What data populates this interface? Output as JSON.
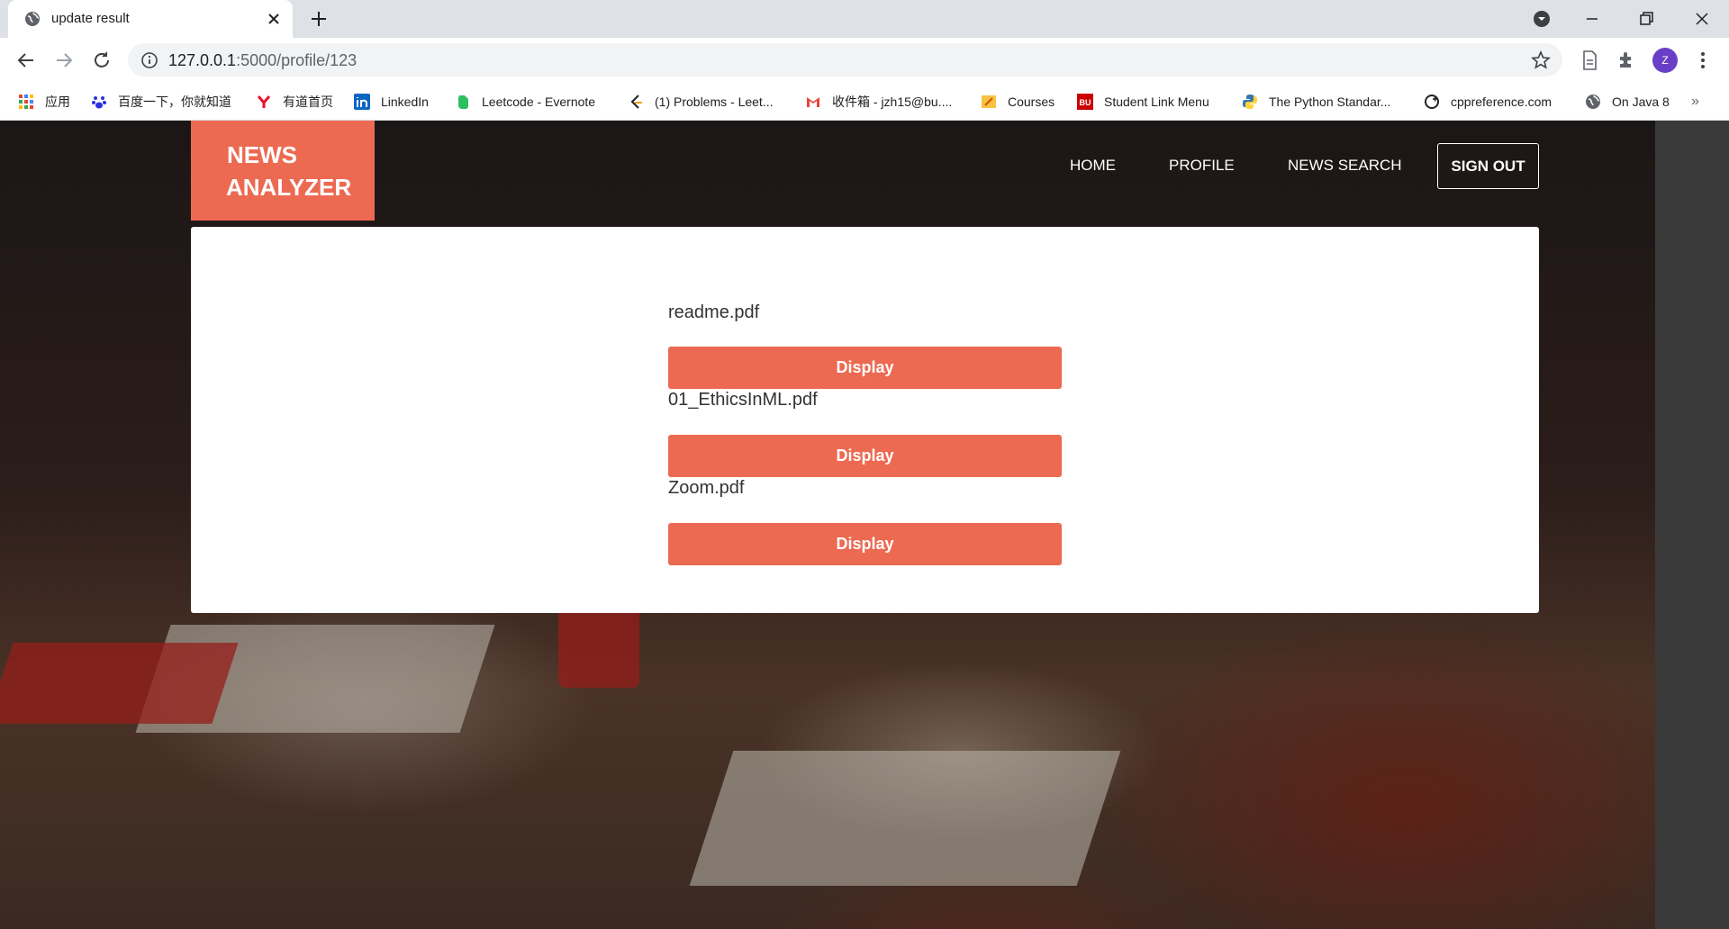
{
  "browser": {
    "tab_title": "update result",
    "url_host": "127.0.0.1",
    "url_rest": ":5000/profile/123",
    "avatar_letter": "Z",
    "bookmarks": [
      {
        "label": "应用",
        "icon": "apps-grid-icon"
      },
      {
        "label": "百度一下，你就知道",
        "icon": "baidu-icon"
      },
      {
        "label": "有道首页",
        "icon": "youdao-icon"
      },
      {
        "label": "LinkedIn",
        "icon": "linkedin-icon"
      },
      {
        "label": "Leetcode - Evernote",
        "icon": "evernote-icon"
      },
      {
        "label": "(1) Problems - Leet...",
        "icon": "leetcode-icon"
      },
      {
        "label": "收件箱 - jzh15@bu....",
        "icon": "gmail-icon"
      },
      {
        "label": "Courses",
        "icon": "courses-icon"
      },
      {
        "label": "Student Link Menu",
        "icon": "bu-icon"
      },
      {
        "label": "The Python Standar...",
        "icon": "python-icon"
      },
      {
        "label": "cppreference.com",
        "icon": "cppreference-icon"
      },
      {
        "label": "On Java 8",
        "icon": "globe-icon"
      }
    ],
    "bookmarks_more": "»"
  },
  "site": {
    "logo_line1": "NEWS",
    "logo_line2": "ANALYZER",
    "nav": {
      "home": "HOME",
      "profile": "PROFILE",
      "news_search": "NEWS SEARCH",
      "sign_out": "SIGN OUT"
    },
    "brand_color": "#ec6a52"
  },
  "files": [
    {
      "name": "readme.pdf",
      "button": "Display"
    },
    {
      "name": "01_EthicsInML.pdf",
      "button": "Display"
    },
    {
      "name": "Zoom.pdf",
      "button": "Display"
    }
  ]
}
